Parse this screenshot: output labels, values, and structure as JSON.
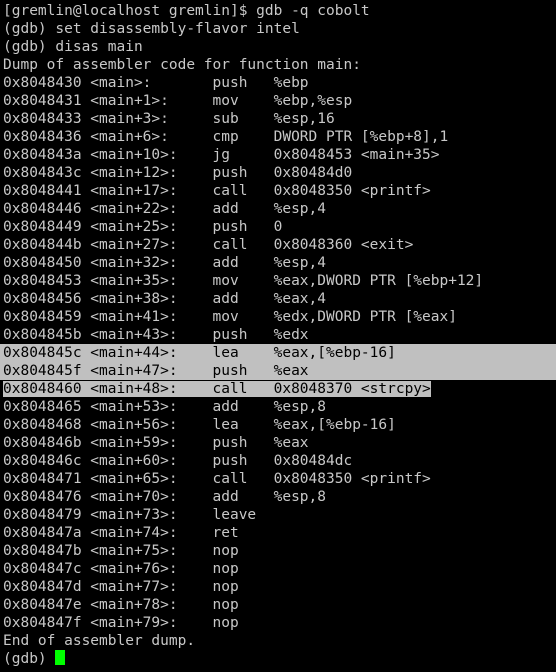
{
  "terminal": {
    "title": "gdb disassembly session",
    "colors": {
      "background": "#000000",
      "foreground": "#c8c8c8",
      "selection_background": "#c0c0c0",
      "selection_foreground": "#000000",
      "cursor": "#00ff00"
    },
    "shell_prompt": "[gremlin@localhost gremlin]$",
    "shell_command": "gdb -q cobolt",
    "gdb_prompt": "(gdb)",
    "commands": [
      "set disassembly-flavor intel",
      "disas main"
    ],
    "dump_header": "Dump of assembler code for function main:",
    "dump_footer": "End of assembler dump.",
    "final_prompt": "(gdb)"
  },
  "lines": [
    {
      "kind": "shell",
      "text": "[gremlin@localhost gremlin]$ gdb -q cobolt"
    },
    {
      "kind": "gdb_cmd",
      "text": "(gdb) set disassembly-flavor intel"
    },
    {
      "kind": "gdb_cmd",
      "text": "(gdb) disas main"
    },
    {
      "kind": "header",
      "text": "Dump of assembler code for function main:"
    }
  ],
  "disassembly": {
    "function": "main",
    "flavor": "intel",
    "columns": [
      "address",
      "symbol",
      "mnemonic",
      "operands"
    ],
    "instructions": [
      {
        "address": "0x8048430",
        "symbol": "<main>:",
        "mnemonic": "push",
        "operands": "%ebp",
        "selected": false
      },
      {
        "address": "0x8048431",
        "symbol": "<main+1>:",
        "mnemonic": "mov",
        "operands": "%ebp,%esp",
        "selected": false
      },
      {
        "address": "0x8048433",
        "symbol": "<main+3>:",
        "mnemonic": "sub",
        "operands": "%esp,16",
        "selected": false
      },
      {
        "address": "0x8048436",
        "symbol": "<main+6>:",
        "mnemonic": "cmp",
        "operands": "DWORD PTR [%ebp+8],1",
        "selected": false
      },
      {
        "address": "0x804843a",
        "symbol": "<main+10>:",
        "mnemonic": "jg",
        "operands": "0x8048453 <main+35>",
        "selected": false
      },
      {
        "address": "0x804843c",
        "symbol": "<main+12>:",
        "mnemonic": "push",
        "operands": "0x80484d0",
        "selected": false
      },
      {
        "address": "0x8048441",
        "symbol": "<main+17>:",
        "mnemonic": "call",
        "operands": "0x8048350 <printf>",
        "selected": false
      },
      {
        "address": "0x8048446",
        "symbol": "<main+22>:",
        "mnemonic": "add",
        "operands": "%esp,4",
        "selected": false
      },
      {
        "address": "0x8048449",
        "symbol": "<main+25>:",
        "mnemonic": "push",
        "operands": "0",
        "selected": false
      },
      {
        "address": "0x804844b",
        "symbol": "<main+27>:",
        "mnemonic": "call",
        "operands": "0x8048360 <exit>",
        "selected": false
      },
      {
        "address": "0x8048450",
        "symbol": "<main+32>:",
        "mnemonic": "add",
        "operands": "%esp,4",
        "selected": false
      },
      {
        "address": "0x8048453",
        "symbol": "<main+35>:",
        "mnemonic": "mov",
        "operands": "%eax,DWORD PTR [%ebp+12]",
        "selected": false
      },
      {
        "address": "0x8048456",
        "symbol": "<main+38>:",
        "mnemonic": "add",
        "operands": "%eax,4",
        "selected": false
      },
      {
        "address": "0x8048459",
        "symbol": "<main+41>:",
        "mnemonic": "mov",
        "operands": "%edx,DWORD PTR [%eax]",
        "selected": false
      },
      {
        "address": "0x804845b",
        "symbol": "<main+43>:",
        "mnemonic": "push",
        "operands": "%edx",
        "selected": false
      },
      {
        "address": "0x804845c",
        "symbol": "<main+44>:",
        "mnemonic": "lea",
        "operands": "%eax,[%ebp-16]",
        "selected": true,
        "select_mode": "full"
      },
      {
        "address": "0x804845f",
        "symbol": "<main+47>:",
        "mnemonic": "push",
        "operands": "%eax",
        "selected": true,
        "select_mode": "full"
      },
      {
        "address": "0x8048460",
        "symbol": "<main+48>:",
        "mnemonic": "call",
        "operands": "0x8048370 <strcpy>",
        "selected": true,
        "select_mode": "partial"
      },
      {
        "address": "0x8048465",
        "symbol": "<main+53>:",
        "mnemonic": "add",
        "operands": "%esp,8",
        "selected": false
      },
      {
        "address": "0x8048468",
        "symbol": "<main+56>:",
        "mnemonic": "lea",
        "operands": "%eax,[%ebp-16]",
        "selected": false
      },
      {
        "address": "0x804846b",
        "symbol": "<main+59>:",
        "mnemonic": "push",
        "operands": "%eax",
        "selected": false
      },
      {
        "address": "0x804846c",
        "symbol": "<main+60>:",
        "mnemonic": "push",
        "operands": "0x80484dc",
        "selected": false
      },
      {
        "address": "0x8048471",
        "symbol": "<main+65>:",
        "mnemonic": "call",
        "operands": "0x8048350 <printf>",
        "selected": false
      },
      {
        "address": "0x8048476",
        "symbol": "<main+70>:",
        "mnemonic": "add",
        "operands": "%esp,8",
        "selected": false
      },
      {
        "address": "0x8048479",
        "symbol": "<main+73>:",
        "mnemonic": "leave",
        "operands": "",
        "selected": false
      },
      {
        "address": "0x804847a",
        "symbol": "<main+74>:",
        "mnemonic": "ret",
        "operands": "",
        "selected": false
      },
      {
        "address": "0x804847b",
        "symbol": "<main+75>:",
        "mnemonic": "nop",
        "operands": "",
        "selected": false
      },
      {
        "address": "0x804847c",
        "symbol": "<main+76>:",
        "mnemonic": "nop",
        "operands": "",
        "selected": false
      },
      {
        "address": "0x804847d",
        "symbol": "<main+77>:",
        "mnemonic": "nop",
        "operands": "",
        "selected": false
      },
      {
        "address": "0x804847e",
        "symbol": "<main+78>:",
        "mnemonic": "nop",
        "operands": "",
        "selected": false
      },
      {
        "address": "0x804847f",
        "symbol": "<main+79>:",
        "mnemonic": "nop",
        "operands": "",
        "selected": false
      }
    ]
  }
}
